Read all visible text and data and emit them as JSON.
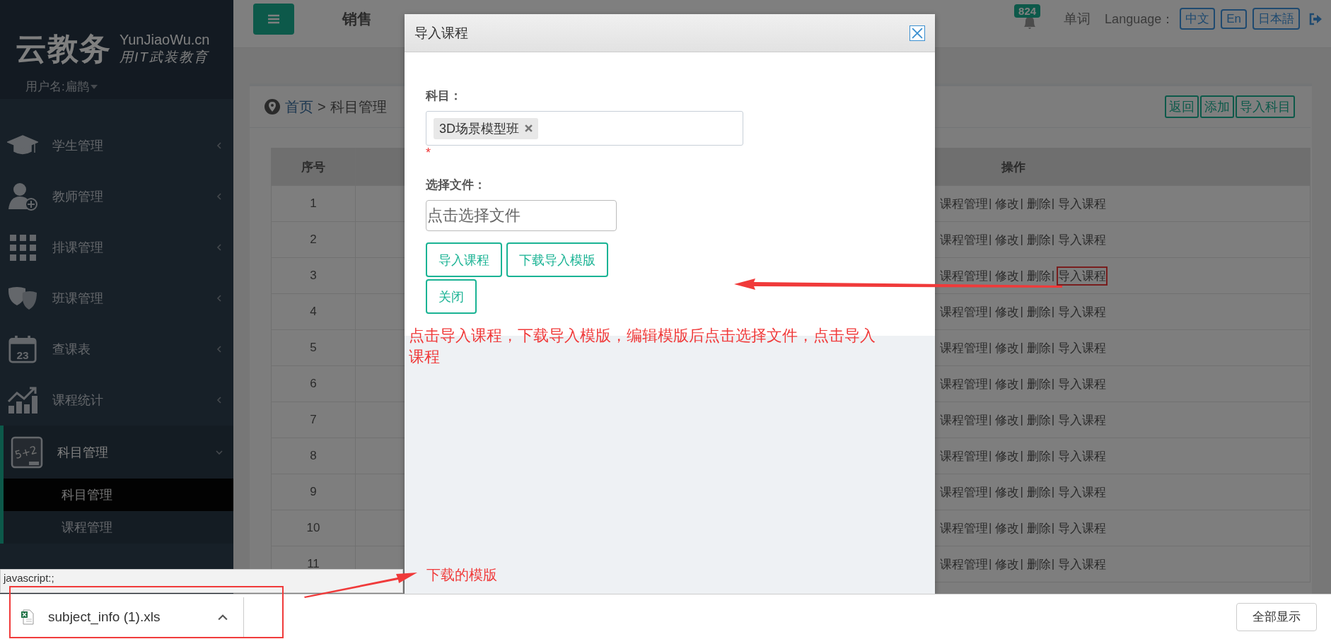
{
  "sidebar": {
    "logo": {
      "name": "云教务",
      "domain": "YunJiaoWu.cn",
      "slogan": "用IT武装教育"
    },
    "user": "用户名:扁鹊",
    "menu": [
      {
        "label": "学生管理",
        "kind": "cap",
        "expanded": false
      },
      {
        "label": "教师管理",
        "kind": "teacher",
        "expanded": false
      },
      {
        "label": "排课管理",
        "kind": "grid",
        "expanded": false
      },
      {
        "label": "班课管理",
        "kind": "masks",
        "expanded": false
      },
      {
        "label": "查课表",
        "kind": "calendar",
        "icon_text": "23",
        "expanded": false
      },
      {
        "label": "课程统计",
        "kind": "chart",
        "expanded": false
      },
      {
        "label": "科目管理",
        "kind": "board",
        "icon_text": "5+2",
        "expanded": true,
        "children": [
          {
            "label": "科目管理",
            "selected": true
          },
          {
            "label": "课程管理",
            "selected": false
          }
        ]
      }
    ]
  },
  "topbar": {
    "tabs": [
      {
        "label": "销售"
      }
    ],
    "notifications": "824",
    "words_link": "单词",
    "language_label": "Language：",
    "languages": [
      "中文",
      "En",
      "日本語"
    ]
  },
  "breadcrumb": {
    "home": "首页",
    "separator": ">",
    "current": "科目管理"
  },
  "toolbar": [
    "返回",
    "添加",
    "导入科目"
  ],
  "table": {
    "columns": [
      "序号",
      "操作"
    ],
    "separator": "|",
    "rows": [
      {
        "number": "1",
        "actions": [
          "课程管理",
          "修改",
          "删除",
          "导入课程"
        ],
        "marked": false
      },
      {
        "number": "2",
        "actions": [
          "课程管理",
          "修改",
          "删除",
          "导入课程"
        ],
        "marked": false
      },
      {
        "number": "3",
        "actions": [
          "课程管理",
          "修改",
          "删除",
          "导入课程"
        ],
        "marked": true
      },
      {
        "number": "4",
        "actions": [
          "课程管理",
          "修改",
          "删除",
          "导入课程"
        ],
        "marked": false
      },
      {
        "number": "5",
        "actions": [
          "课程管理",
          "修改",
          "删除",
          "导入课程"
        ],
        "marked": false
      },
      {
        "number": "6",
        "actions": [
          "课程管理",
          "修改",
          "删除",
          "导入课程"
        ],
        "marked": false
      },
      {
        "number": "7",
        "actions": [
          "课程管理",
          "修改",
          "删除",
          "导入课程"
        ],
        "marked": false
      },
      {
        "number": "8",
        "actions": [
          "课程管理",
          "修改",
          "删除",
          "导入课程"
        ],
        "marked": false
      },
      {
        "number": "9",
        "actions": [
          "课程管理",
          "修改",
          "删除",
          "导入课程"
        ],
        "marked": false
      },
      {
        "number": "10",
        "actions": [
          "课程管理",
          "修改",
          "删除",
          "导入课程"
        ],
        "marked": false
      },
      {
        "number": "11",
        "actions": [
          "课程管理",
          "修改",
          "删除",
          "导入课程"
        ],
        "marked": false
      }
    ]
  },
  "dialog": {
    "title": "导入课程",
    "subject_label": "科目：",
    "subject_tags": [
      "3D场景模型班"
    ],
    "required_mark": "*",
    "file_label": "选择文件：",
    "file_placeholder": "点击选择文件",
    "buttons": [
      "导入课程",
      "下载导入模版",
      "关闭"
    ]
  },
  "status_url": "javascript:;",
  "downloads": {
    "items": [
      {
        "file": "subject_info (1).xls",
        "marked": true
      }
    ],
    "show_all": "全部显示"
  },
  "annotations": [
    {
      "kind": "note",
      "text": "点击导入课程，下载导入模版，编辑模版后点击选择文件，点击导入课程"
    },
    {
      "kind": "label",
      "text": "下载的模版"
    }
  ]
}
